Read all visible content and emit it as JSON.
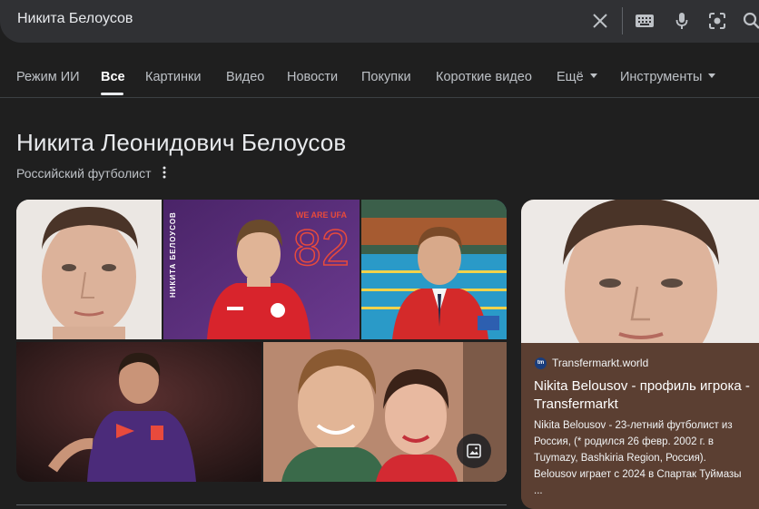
{
  "search": {
    "query": "Никита Белоусов"
  },
  "tabs": [
    {
      "label": "Режим ИИ"
    },
    {
      "label": "Все"
    },
    {
      "label": "Картинки"
    },
    {
      "label": "Видео"
    },
    {
      "label": "Новости"
    },
    {
      "label": "Покупки"
    },
    {
      "label": "Короткие видео"
    },
    {
      "label": "Ещё"
    },
    {
      "label": "Инструменты"
    }
  ],
  "entity": {
    "title": "Никита Леонидович Белоусов",
    "subtitle": "Российский футболист"
  },
  "images": {
    "poster_text_side": "НИКИТА БЕЛОУСОВ",
    "poster_brand": "WE ARE UFA",
    "poster_number": "82"
  },
  "card": {
    "source": "Transfermarkt.world",
    "logo_text": "tm",
    "title": "Nikita Belousov - профиль игрока - Transfermarkt",
    "description": "Nikita Belousov - 23-летний футболист из Россия, (* родился 26 февр. 2002 г. в Tuymazy, Bashkiria Region, Россия). Belousov играет с 2024 в Спартак Туймазы ..."
  },
  "icons": [
    "close-icon",
    "keyboard-icon",
    "microphone-icon",
    "lens-icon",
    "search-icon",
    "more-vert-icon",
    "image-search-icon"
  ]
}
